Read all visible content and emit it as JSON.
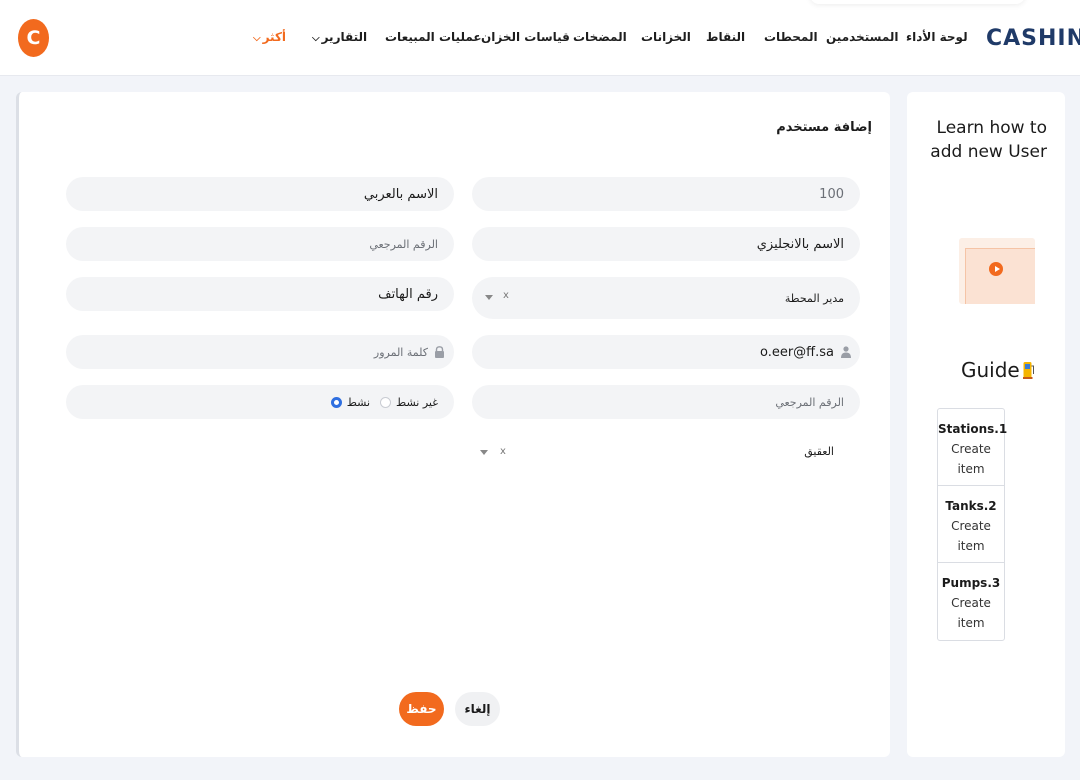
{
  "header": {
    "logo": "CASHIN",
    "avatar_letter": "C",
    "nav": [
      {
        "label": "لوحة الأداء"
      },
      {
        "label": "المستخدمين"
      },
      {
        "label": "المحطات"
      },
      {
        "label": "النقاط"
      },
      {
        "label": "الخزانات"
      },
      {
        "label": "المضخات"
      },
      {
        "label": "قياسات الخزان"
      },
      {
        "label": "عمليات المبيعات"
      },
      {
        "label": "التقارير"
      },
      {
        "label": "أكثر"
      }
    ],
    "accent_color": "#f26a1e"
  },
  "form": {
    "title": "إضافة مستخدم",
    "fields": {
      "number": "100",
      "arabic_name": "الاسم بالعربي",
      "english_name": "الاسم بالانجليزي",
      "reference_number_placeholder": "الرقم المرجعي",
      "role_value": "مدير المحطة",
      "phone": "رقم الهاتف",
      "email": "o.eer@ff.sa",
      "password_placeholder": "كلمة المرور",
      "reference_number_2_placeholder": "الرقم المرجعي",
      "station_value": "العقيق",
      "clear_mark": "x"
    },
    "status": {
      "active_label": "نشط",
      "inactive_label": "غير نشط",
      "selected": "active"
    },
    "buttons": {
      "save": "حفظ",
      "cancel": "إلغاء"
    }
  },
  "side_panel": {
    "title": "Learn how to add new User",
    "guide_label": "Guide",
    "steps": [
      {
        "title": "Stations.1",
        "line1": "Create",
        "line2": "item"
      },
      {
        "title": "Tanks.2",
        "line1": "Create",
        "line2": "item"
      },
      {
        "title": "Pumps.3",
        "line1": "Create",
        "line2": "item"
      }
    ]
  }
}
